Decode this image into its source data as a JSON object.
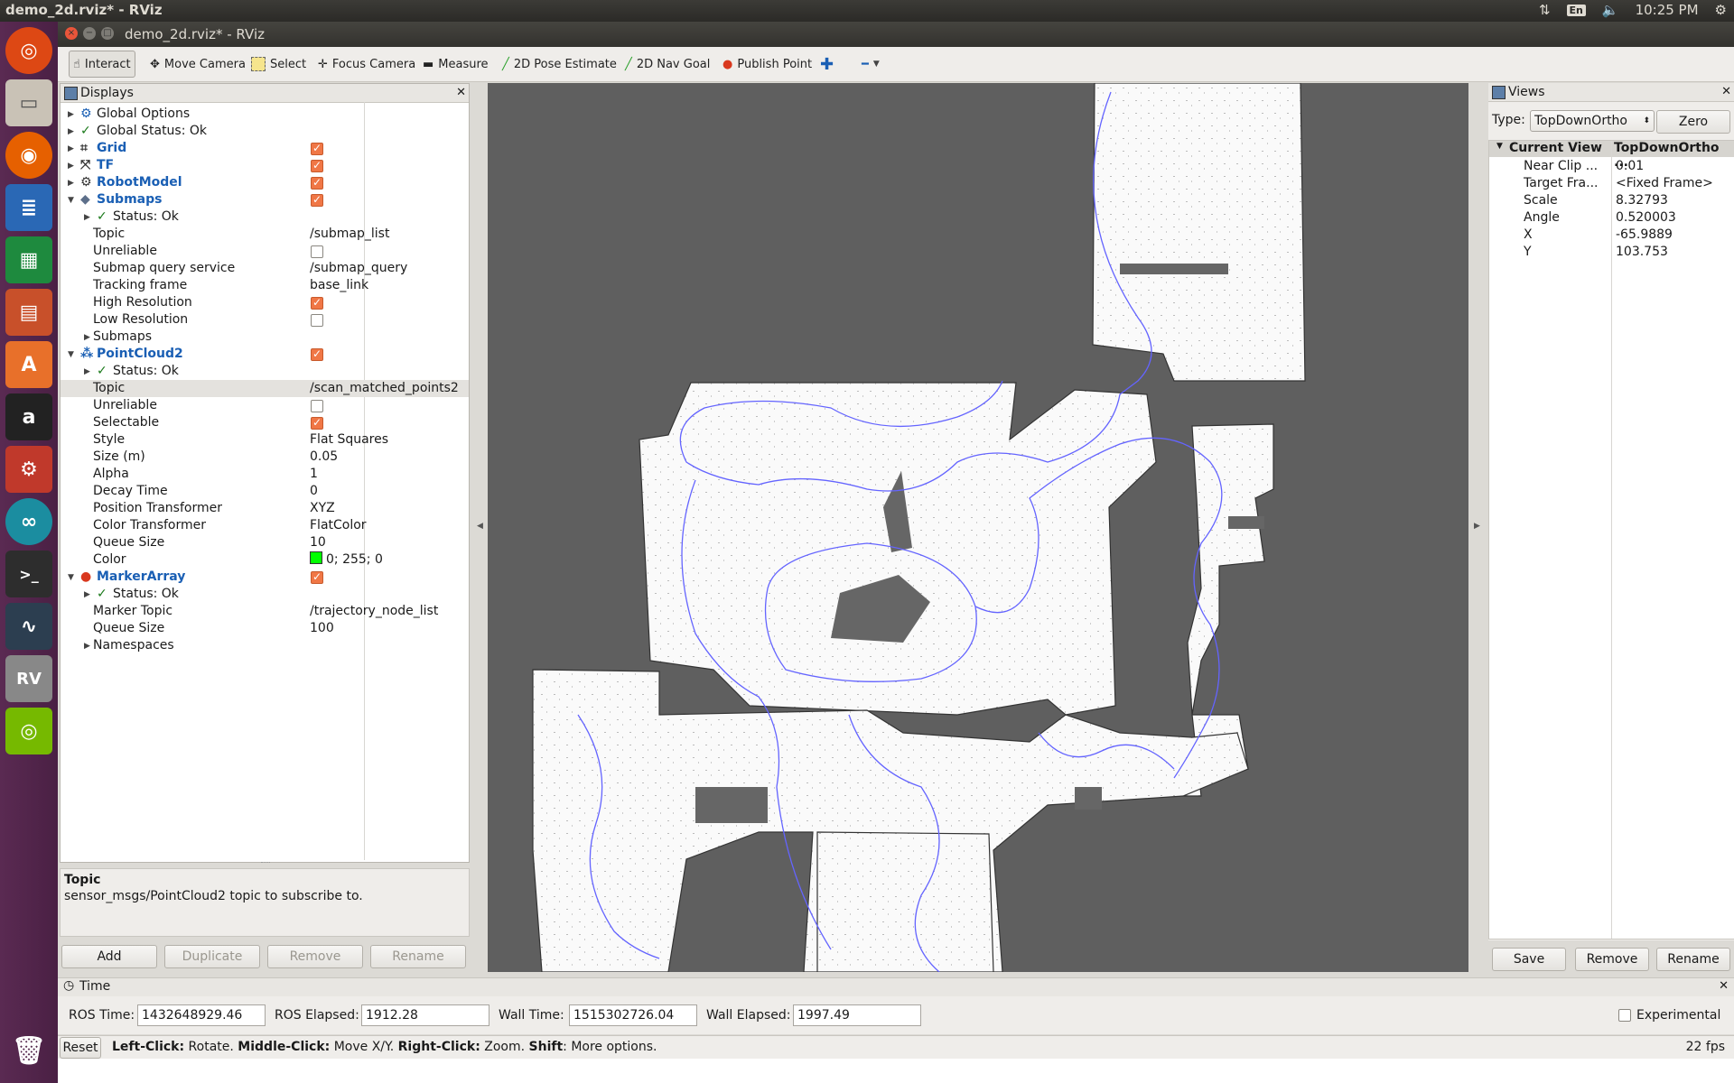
{
  "system_bar": {
    "window_title": "demo_2d.rviz* - RViz",
    "lang": "En",
    "clock": "10:25 PM"
  },
  "window": {
    "title": "demo_2d.rviz* - RViz"
  },
  "toolbar": {
    "interact": "Interact",
    "move_camera": "Move Camera",
    "select": "Select",
    "focus_camera": "Focus Camera",
    "measure": "Measure",
    "pose_estimate": "2D Pose Estimate",
    "nav_goal": "2D Nav Goal",
    "publish_point": "Publish Point"
  },
  "displays": {
    "title": "Displays",
    "rows": [
      {
        "label": "Global Options"
      },
      {
        "label": "Global Status: Ok"
      },
      {
        "label": "Grid"
      },
      {
        "label": "TF"
      },
      {
        "label": "RobotModel"
      },
      {
        "label": "Submaps"
      },
      {
        "label": "Status: Ok"
      },
      {
        "label": "Topic",
        "value": "/submap_list"
      },
      {
        "label": "Unreliable"
      },
      {
        "label": "Submap query service",
        "value": "/submap_query"
      },
      {
        "label": "Tracking frame",
        "value": "base_link"
      },
      {
        "label": "High Resolution"
      },
      {
        "label": "Low Resolution"
      },
      {
        "label": "Submaps"
      },
      {
        "label": "PointCloud2"
      },
      {
        "label": "Status: Ok"
      },
      {
        "label": "Topic",
        "value": "/scan_matched_points2"
      },
      {
        "label": "Unreliable"
      },
      {
        "label": "Selectable"
      },
      {
        "label": "Style",
        "value": "Flat Squares"
      },
      {
        "label": "Size (m)",
        "value": "0.05"
      },
      {
        "label": "Alpha",
        "value": "1"
      },
      {
        "label": "Decay Time",
        "value": "0"
      },
      {
        "label": "Position Transformer",
        "value": "XYZ"
      },
      {
        "label": "Color Transformer",
        "value": "FlatColor"
      },
      {
        "label": "Queue Size",
        "value": "10"
      },
      {
        "label": "Color",
        "value": "0; 255; 0"
      },
      {
        "label": "MarkerArray"
      },
      {
        "label": "Status: Ok"
      },
      {
        "label": "Marker Topic",
        "value": "/trajectory_node_list"
      },
      {
        "label": "Queue Size",
        "value": "100"
      },
      {
        "label": "Namespaces"
      }
    ],
    "description_title": "Topic",
    "description_text": "sensor_msgs/PointCloud2 topic to subscribe to.",
    "buttons": {
      "add": "Add",
      "duplicate": "Duplicate",
      "remove": "Remove",
      "rename": "Rename"
    }
  },
  "views": {
    "title": "Views",
    "type_label": "Type:",
    "type_value": "TopDownOrtho",
    "zero": "Zero",
    "header_label": "Current View",
    "header_value": "TopDownOrtho ...",
    "props": [
      {
        "label": "Near Clip ...",
        "value": "0.01"
      },
      {
        "label": "Target Fra...",
        "value": "<Fixed Frame>"
      },
      {
        "label": "Scale",
        "value": "8.32793"
      },
      {
        "label": "Angle",
        "value": "0.520003"
      },
      {
        "label": "X",
        "value": "-65.9889"
      },
      {
        "label": "Y",
        "value": "103.753"
      }
    ],
    "buttons": {
      "save": "Save",
      "remove": "Remove",
      "rename": "Rename"
    }
  },
  "time": {
    "title": "Time",
    "ros_time_label": "ROS Time:",
    "ros_time": "1432648929.46",
    "ros_elapsed_label": "ROS Elapsed:",
    "ros_elapsed": "1912.28",
    "wall_time_label": "Wall Time:",
    "wall_time": "1515302726.04",
    "wall_elapsed_label": "Wall Elapsed:",
    "wall_elapsed": "1997.49",
    "experimental": "Experimental"
  },
  "status": {
    "reset": "Reset",
    "left_click": "Left-Click:",
    "left_click_desc": "Rotate.",
    "middle_click": "Middle-Click:",
    "middle_click_desc": "Move X/Y.",
    "right_click": "Right-Click:",
    "right_click_desc": "Zoom.",
    "shift": "Shift",
    "shift_desc": ": More options.",
    "fps": "22 fps"
  },
  "colors": {
    "accent": "#f07746",
    "link_blue": "#1a5fb4",
    "map_bg": "#5f5f5f",
    "trajectory": "#6464ff"
  }
}
